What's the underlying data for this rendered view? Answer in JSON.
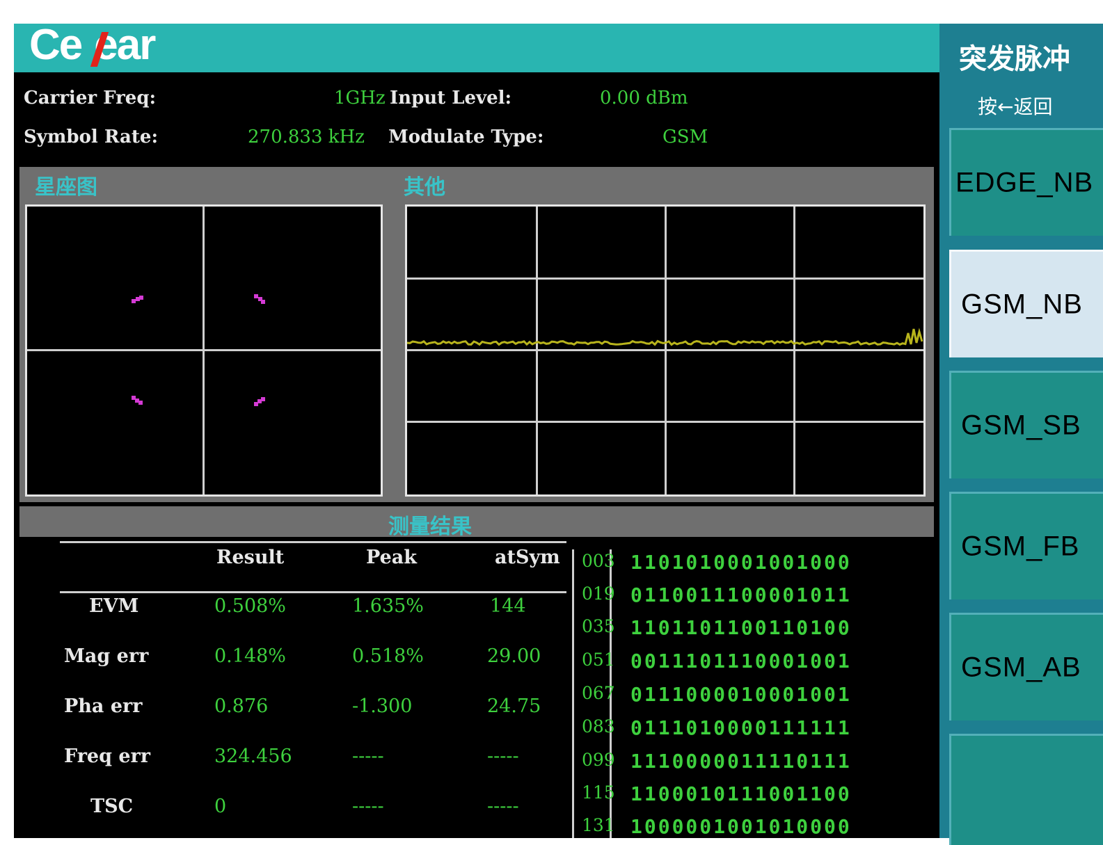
{
  "brand": {
    "logo": "Ceyear"
  },
  "info": {
    "carrier_freq_label": "Carrier Freq:",
    "carrier_freq_value": "1GHz",
    "input_level_label": "Input Level:",
    "input_level_value": "0.00 dBm",
    "symbol_rate_label": "Symbol Rate:",
    "symbol_rate_value": "270.833 kHz",
    "modulate_type_label": "Modulate Type:",
    "modulate_type_value": "GSM"
  },
  "panels": {
    "constellation_title": "星座图",
    "other_title": "其他",
    "results_title": "测量结果"
  },
  "results": {
    "headers": [
      "Result",
      "Peak",
      "atSym"
    ],
    "rows": [
      {
        "name": "EVM",
        "result": "0.508%",
        "peak": "1.635%",
        "atsym": "144"
      },
      {
        "name": "Mag err",
        "result": "0.148%",
        "peak": "0.518%",
        "atsym": "29.00"
      },
      {
        "name": "Pha err",
        "result": "0.876",
        "peak": "-1.300",
        "atsym": "24.75"
      },
      {
        "name": "Freq err",
        "result": "324.456",
        "peak": "-----",
        "atsym": "-----"
      },
      {
        "name": "TSC",
        "result": "0",
        "peak": "-----",
        "atsym": "-----"
      }
    ]
  },
  "bits": [
    {
      "idx": "003",
      "val": "1101010001001000"
    },
    {
      "idx": "019",
      "val": "0110011100001011"
    },
    {
      "idx": "035",
      "val": "1101101100110100"
    },
    {
      "idx": "051",
      "val": "0011101110001001"
    },
    {
      "idx": "067",
      "val": "0111000010001001"
    },
    {
      "idx": "083",
      "val": "0111010000111111"
    },
    {
      "idx": "099",
      "val": "1110000011110111"
    },
    {
      "idx": "115",
      "val": "1100010111001100"
    },
    {
      "idx": "131",
      "val": "1000001001010000"
    }
  ],
  "sidebar": {
    "title": "突发脉冲",
    "subtitle": "按←返回",
    "softkeys": [
      {
        "label": "EDGE_NB"
      },
      {
        "label": "GSM_NB",
        "active": true
      },
      {
        "label": "GSM_SB"
      },
      {
        "label": "GSM_FB"
      },
      {
        "label": "GSM_AB"
      },
      {
        "label": ""
      }
    ]
  },
  "colors": {
    "header_teal": "#29b5b1",
    "value_green": "#3ed13e",
    "constellation_magenta": "#d43ad4",
    "trace_yellow": "#b8b41c",
    "panel_title_cyan": "#39c3c8",
    "sidebar_blue": "#1e7f91",
    "softkey_teal": "#1e8f88",
    "softkey_active": "#d6e6f0"
  }
}
